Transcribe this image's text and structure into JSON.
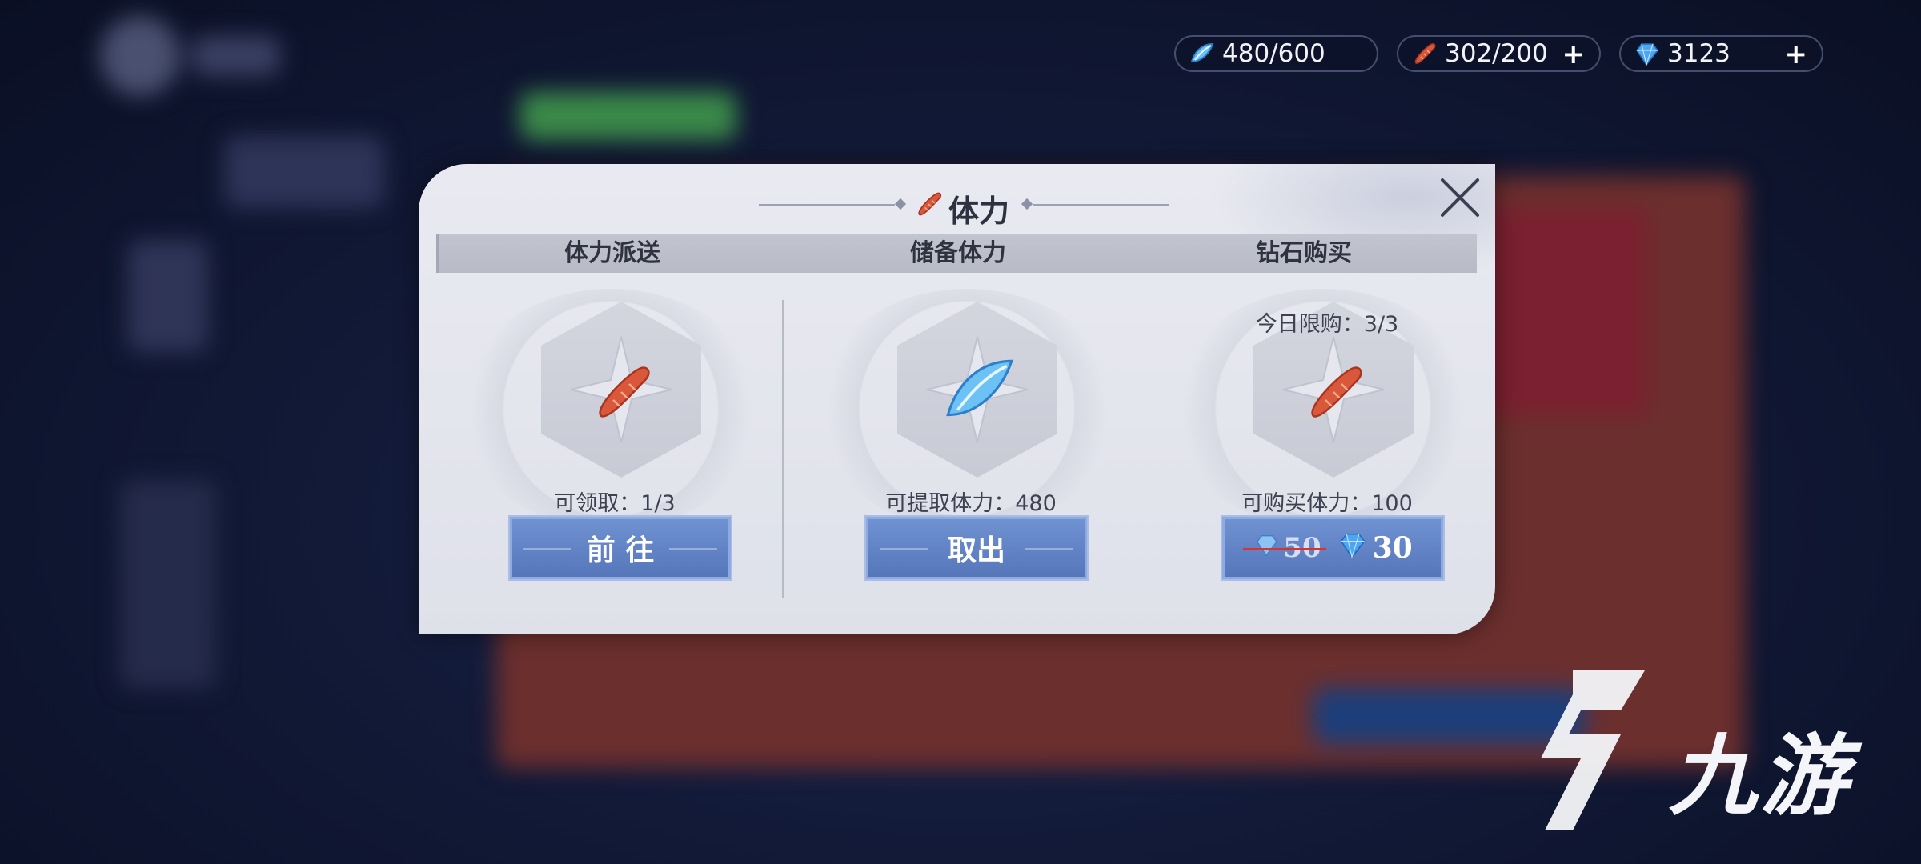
{
  "resources": {
    "stamina": {
      "value": "480/600",
      "icon": "blue-crystal-icon"
    },
    "sausage": {
      "value": "302/200",
      "icon": "sausage-icon",
      "plus": "+"
    },
    "diamond": {
      "value": "3123",
      "icon": "diamond-icon",
      "plus": "+"
    }
  },
  "dialog": {
    "title": "体力",
    "columns": [
      {
        "header": "体力派送",
        "info": "可领取：1/3",
        "button": "前 往",
        "item_icon": "sausage-icon"
      },
      {
        "header": "储备体力",
        "info": "可提取体力：480",
        "button": "取出",
        "item_icon": "blue-crystal-icon"
      },
      {
        "header": "钻石购买",
        "limit": "今日限购：3/3",
        "info": "可购买体力：100",
        "old_price": "50",
        "new_price": "30",
        "item_icon": "sausage-icon"
      }
    ]
  },
  "watermark": {
    "text": "九游"
  },
  "colors": {
    "button_blue": "#5f80c4",
    "sausage": "#d9573a",
    "crystal": "#5ab3ef",
    "strike_red": "#d8342c"
  }
}
